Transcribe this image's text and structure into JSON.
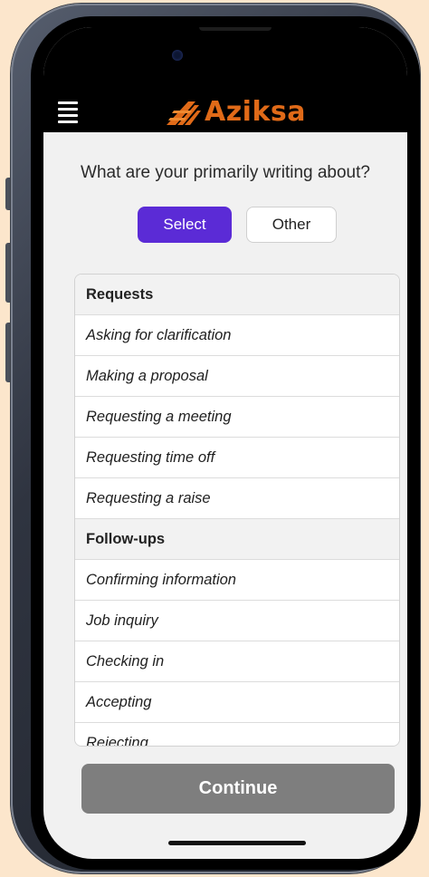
{
  "app": {
    "logo_text": "Aziksa",
    "brand_color": "#e06a18",
    "accent_color": "#5b2bd6"
  },
  "header": {
    "menu_icon": "hamburger-menu-icon"
  },
  "main": {
    "question": "What are your primarily writing about?",
    "tabs": [
      {
        "label": "Select",
        "active": true
      },
      {
        "label": "Other",
        "active": false
      }
    ],
    "list": [
      {
        "type": "header",
        "label": "Requests"
      },
      {
        "type": "item",
        "label": "Asking for clarification"
      },
      {
        "type": "item",
        "label": "Making a proposal"
      },
      {
        "type": "item",
        "label": "Requesting a meeting"
      },
      {
        "type": "item",
        "label": "Requesting time off"
      },
      {
        "type": "item",
        "label": "Requesting a raise"
      },
      {
        "type": "header",
        "label": "Follow-ups"
      },
      {
        "type": "item",
        "label": "Confirming information"
      },
      {
        "type": "item",
        "label": "Job inquiry"
      },
      {
        "type": "item",
        "label": "Checking in"
      },
      {
        "type": "item",
        "label": "Accepting"
      },
      {
        "type": "item",
        "label": "Rejecting"
      }
    ],
    "continue_label": "Continue"
  }
}
